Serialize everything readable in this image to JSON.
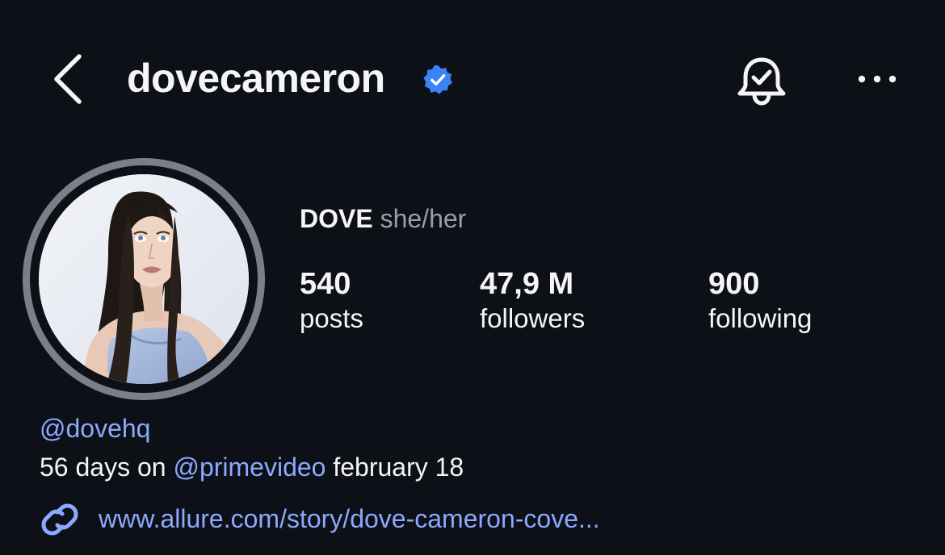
{
  "header": {
    "username": "dovecameron",
    "back_icon": "chevron-left-icon",
    "verified_icon": "verified-badge-icon",
    "notifications_icon": "bell-check-icon",
    "more_icon": "more-horizontal-icon"
  },
  "profile": {
    "name": "DOVE",
    "pronouns": "she/her",
    "avatar_icon": "profile-photo"
  },
  "stats": [
    {
      "value": "540",
      "label": "posts"
    },
    {
      "value": "47,9 M",
      "label": "followers"
    },
    {
      "value": "900",
      "label": "following"
    }
  ],
  "bio": {
    "mention": "@dovehq",
    "line2_prefix": "56 days on ",
    "line2_mention": "@primevideo",
    "line2_suffix": " february 18",
    "link_icon": "link-icon",
    "link": "www.allure.com/story/dove-cameron-cove..."
  },
  "colors": {
    "background": "#0d1016",
    "text": "#f5f5f5",
    "muted": "#9a9ea7",
    "link": "#8ba9ff",
    "verified": "#3b82f6",
    "ring": "#7c7f88"
  }
}
